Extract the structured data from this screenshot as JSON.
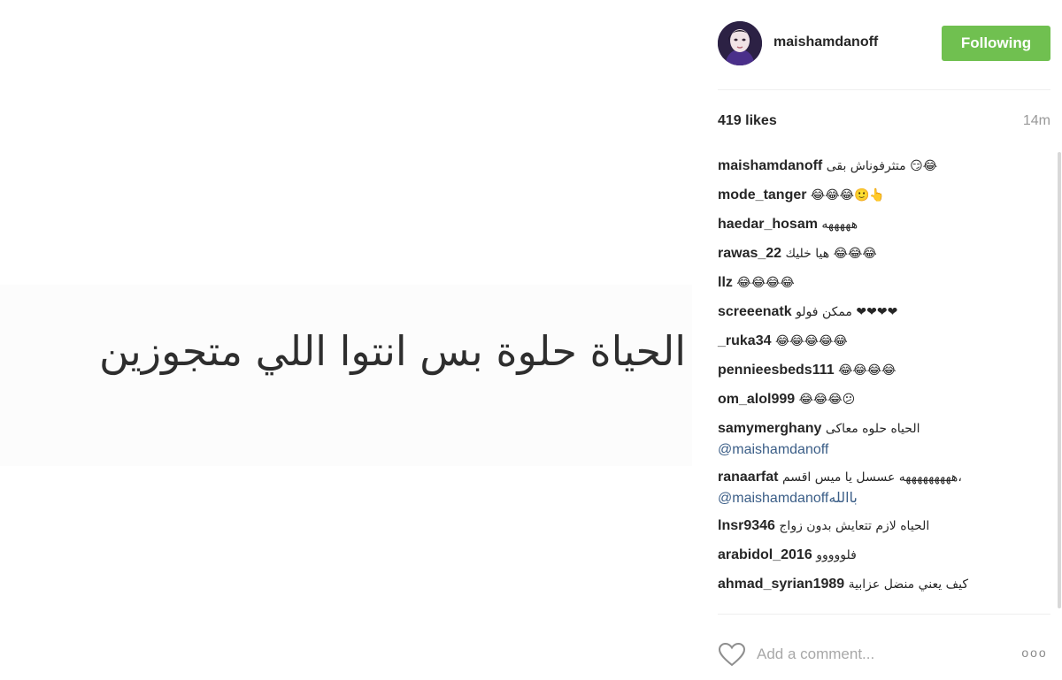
{
  "photo": {
    "text": "الحياة حلوة بس انتوا اللي متجوزين"
  },
  "header": {
    "username": "maishamdanoff",
    "follow_label": "Following"
  },
  "stats": {
    "likes": "419 likes",
    "time": "14m"
  },
  "comments": [
    {
      "user": "maishamdanoff",
      "text": "متثرفوناش بقى 😏😂"
    },
    {
      "user": "mode_tanger",
      "text": "😂😂😂🙂👆"
    },
    {
      "user": "haedar_hosam",
      "text": "هههههه"
    },
    {
      "user": "rawas_22",
      "text": "هيا خليك 😂😂😂"
    },
    {
      "user": "llz",
      "text": "😂😂😂😂"
    },
    {
      "user": "screeenatk",
      "text": "ممكن فولو ❤❤❤❤"
    },
    {
      "user": "_ruka34",
      "text": "😂😂😂😂😂"
    },
    {
      "user": "pennieesbeds111",
      "text": "😂😂😂😂"
    },
    {
      "user": "om_alol999",
      "text": "😂😂😂😕"
    },
    {
      "user": "samymerghany",
      "text": "الحياه حلوه معاكى",
      "mention": "@maishamdanoff"
    },
    {
      "user": "ranaarfat",
      "text": "هههههههههه عسسل يا ميس اقسم،",
      "mention": "@maishamdanoffباالله"
    },
    {
      "user": "lnsr9346",
      "text": "الحياه لازم تتعايش بدون زواج"
    },
    {
      "user": "arabidol_2016",
      "text": "فلووووو"
    },
    {
      "user": "ahmad_syrian1989",
      "text": "كيف يعني منضل عزابية"
    }
  ],
  "footer": {
    "comment_placeholder": "Add a comment...",
    "more_label": "ooo"
  },
  "colors": {
    "follow_green": "#70c050",
    "mention_blue": "#3b5e87",
    "muted_gray": "#999999"
  },
  "icons": {
    "heart": "heart-outline-icon",
    "more": "more-options-icon"
  }
}
